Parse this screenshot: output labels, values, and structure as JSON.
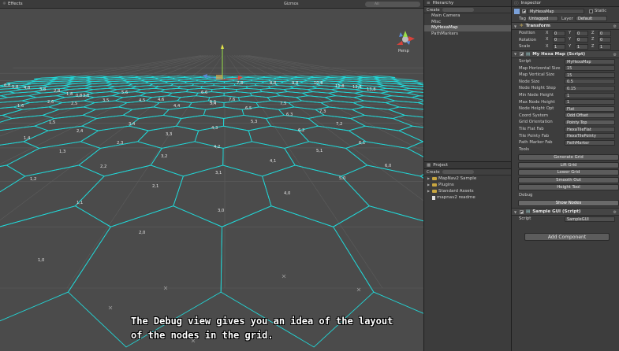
{
  "scene": {
    "effects_label": "Effects",
    "gizmos_label": "Gizmos",
    "search_placeholder": "All",
    "persp_label": "Persp",
    "caption_line1": "The Debug view gives you an idea of the layout",
    "caption_line2": "of the nodes in the grid.",
    "hex_stroke_color": "#22d6d6",
    "hex_labels": [
      {
        "t": "6,8"
      },
      {
        "t": "5,8"
      },
      {
        "t": "4,8"
      },
      {
        "t": "3,8"
      },
      {
        "t": "2,8"
      },
      {
        "t": "1,8"
      },
      {
        "t": "0,8"
      },
      {
        "t": "7,8"
      },
      {
        "t": "8,8"
      },
      {
        "t": "9,8"
      },
      {
        "t": "10,8"
      },
      {
        "t": "11,8"
      },
      {
        "t": "12,8"
      },
      {
        "t": "13,8"
      },
      {
        "t": "5,6"
      },
      {
        "t": "4,6"
      },
      {
        "t": "3,6"
      },
      {
        "t": "2,6"
      },
      {
        "t": "1,6"
      },
      {
        "t": "6,6"
      },
      {
        "t": "7,6"
      },
      {
        "t": "4,5"
      },
      {
        "t": "5,5"
      },
      {
        "t": "6,5"
      },
      {
        "t": "7,5"
      },
      {
        "t": "3,5"
      },
      {
        "t": "2,5"
      },
      {
        "t": "1,5"
      },
      {
        "t": "3,4"
      },
      {
        "t": "4,4"
      },
      {
        "t": "5,4"
      },
      {
        "t": "7,3"
      },
      {
        "t": "6,3"
      },
      {
        "t": "2,4"
      },
      {
        "t": "3,3"
      },
      {
        "t": "4,3"
      },
      {
        "t": "5,3"
      },
      {
        "t": "6,2"
      },
      {
        "t": "7,2"
      },
      {
        "t": "1,4"
      },
      {
        "t": "2,3"
      },
      {
        "t": "4,2"
      },
      {
        "t": "5,1"
      },
      {
        "t": "6,1"
      },
      {
        "t": "1,3"
      },
      {
        "t": "3,2"
      },
      {
        "t": "4,1"
      },
      {
        "t": "6,0"
      },
      {
        "t": "2,2"
      },
      {
        "t": "3,1"
      },
      {
        "t": "5,0"
      },
      {
        "t": "1,2"
      },
      {
        "t": "2,1"
      },
      {
        "t": "4,0"
      },
      {
        "t": "1,1"
      },
      {
        "t": "3,0"
      },
      {
        "t": "2,0"
      },
      {
        "t": "1,0"
      }
    ]
  },
  "hierarchy": {
    "title": "Hierarchy",
    "create_label": "Create",
    "items": [
      "Main Camera",
      "Misc",
      "MyHexaMap",
      "PathMarkers"
    ]
  },
  "project": {
    "title": "Project",
    "create_label": "Create",
    "items": [
      "MapNav2 Sample",
      "Plugins",
      "Standard Assets",
      "mapnav2 readme"
    ]
  },
  "inspector": {
    "title": "Inspector",
    "object_name": "MyHexaMap",
    "static_label": "Static",
    "tag_label": "Tag",
    "tag_value": "Untagged",
    "layer_label": "Layer",
    "layer_value": "Default",
    "transform": {
      "title": "Transform",
      "position_label": "Position",
      "rotation_label": "Rotation",
      "scale_label": "Scale",
      "position": {
        "x": "0",
        "y": "0",
        "z": "0"
      },
      "rotation": {
        "x": "0",
        "y": "0",
        "z": "0"
      },
      "scale": {
        "x": "1",
        "y": "1",
        "z": "1"
      }
    },
    "hexamap": {
      "title": "My Hexa Map (Script)",
      "fields": [
        {
          "label": "Script",
          "value": "MyHexaMap",
          "kind": "obj"
        },
        {
          "label": "Map Horizontal Size",
          "value": "15",
          "kind": "num"
        },
        {
          "label": "Map Vertical Size",
          "value": "15",
          "kind": "num"
        },
        {
          "label": "Node Size",
          "value": "0.5",
          "kind": "num"
        },
        {
          "label": "Node Height Step",
          "value": "0.15",
          "kind": "num"
        },
        {
          "label": "Min Node Height",
          "value": "1",
          "kind": "num"
        },
        {
          "label": "Max Node Height",
          "value": "1",
          "kind": "num"
        },
        {
          "label": "Node Height Opt",
          "value": "Flat",
          "kind": "enum"
        },
        {
          "label": "Coord System",
          "value": "Odd Offset",
          "kind": "enum"
        },
        {
          "label": "Grid Orientation",
          "value": "Pointy Top",
          "kind": "enum"
        },
        {
          "label": "Tile Flat Fab",
          "value": "HexaTileFlat",
          "kind": "obj"
        },
        {
          "label": "Tile Pointy Fab",
          "value": "HexaTilePointy",
          "kind": "obj"
        },
        {
          "label": "Path Marker Fab",
          "value": "PathMarker",
          "kind": "obj"
        }
      ],
      "tools_label": "Tools",
      "buttons": [
        "Generate Grid",
        "Lift Grid",
        "Lower Grid",
        "Smooth Out",
        "Height Tool"
      ],
      "debug_label": "Debug",
      "debug_button": "Show Nodes"
    },
    "samplegui": {
      "title": "Sample GUI (Script)",
      "script_label": "Script",
      "script_value": "SampleGUI"
    },
    "add_component": "Add Component"
  }
}
